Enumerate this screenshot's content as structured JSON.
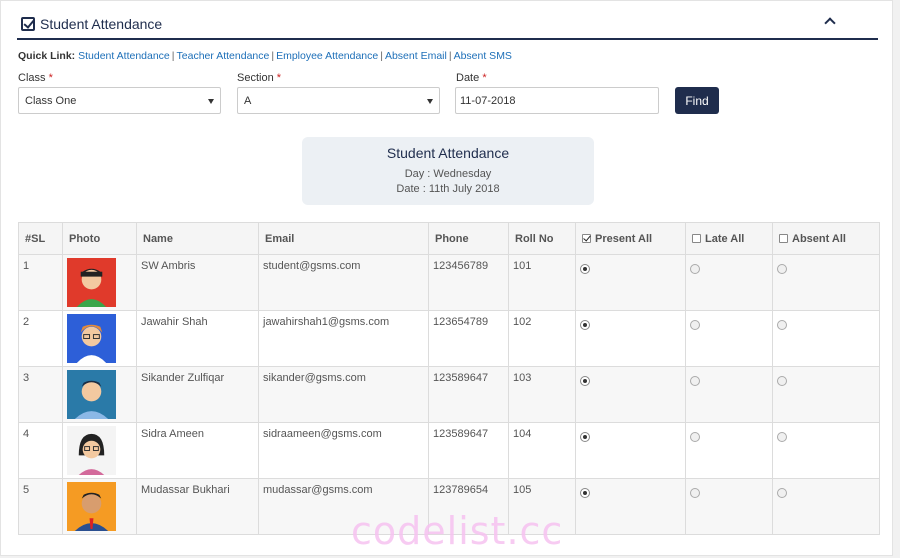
{
  "header": {
    "title": "Student Attendance"
  },
  "quick_links": {
    "label": "Quick Link:",
    "links": [
      "Student Attendance",
      "Teacher Attendance",
      "Employee Attendance",
      "Absent Email",
      "Absent SMS"
    ]
  },
  "filters": {
    "class_label": "Class",
    "class_value": "Class One",
    "section_label": "Section",
    "section_value": "A",
    "date_label": "Date",
    "date_value": "11-07-2018",
    "required_mark": "*",
    "find_label": "Find"
  },
  "summary": {
    "title": "Student Attendance",
    "day": "Day : Wednesday",
    "date": "Date : 11th July 2018"
  },
  "table": {
    "columns": [
      "#SL",
      "Photo",
      "Name",
      "Email",
      "Phone",
      "Roll No",
      "Present All",
      "Late All",
      "Absent All"
    ],
    "present_all_checked": true,
    "rows": [
      {
        "sl": "1",
        "name": "SW Ambris",
        "email": "student@gsms.com",
        "phone": "123456789",
        "roll": "101",
        "status": "present",
        "avatar": "avatar-red"
      },
      {
        "sl": "2",
        "name": "Jawahir Shah",
        "email": "jawahirshah1@gsms.com",
        "phone": "123654789",
        "roll": "102",
        "status": "present",
        "avatar": "avatar-blue-glasses"
      },
      {
        "sl": "3",
        "name": "Sikander Zulfiqar",
        "email": "sikander@gsms.com",
        "phone": "123589647",
        "roll": "103",
        "status": "present",
        "avatar": "avatar-teal"
      },
      {
        "sl": "4",
        "name": "Sidra Ameen",
        "email": "sidraameen@gsms.com",
        "phone": "123589647",
        "roll": "104",
        "status": "present",
        "avatar": "avatar-female"
      },
      {
        "sl": "5",
        "name": "Mudassar Bukhari",
        "email": "mudassar@gsms.com",
        "phone": "123789654",
        "roll": "105",
        "status": "present",
        "avatar": "avatar-orange-suit"
      }
    ]
  },
  "watermark": "codelist.cc",
  "colors": {
    "brand": "#1f2d4d",
    "link": "#1d6fb8",
    "required": "#cc2222"
  }
}
